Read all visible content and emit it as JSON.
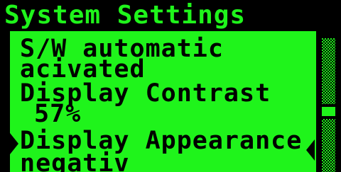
{
  "header": {
    "title": "System Settings"
  },
  "menu": {
    "items": [
      {
        "label": "S/W automatic",
        "value": "acivated"
      },
      {
        "label": "Display Contrast",
        "value": "57%"
      },
      {
        "label": "Display Appearance",
        "value": "negativ"
      }
    ]
  },
  "scrollbar": {
    "position_fraction": 0.55
  },
  "colors": {
    "background": "#1ff41b",
    "foreground": "#000000"
  },
  "icons": {
    "selection_left": "triangle-right-icon",
    "selection_right": "triangle-left-icon"
  }
}
